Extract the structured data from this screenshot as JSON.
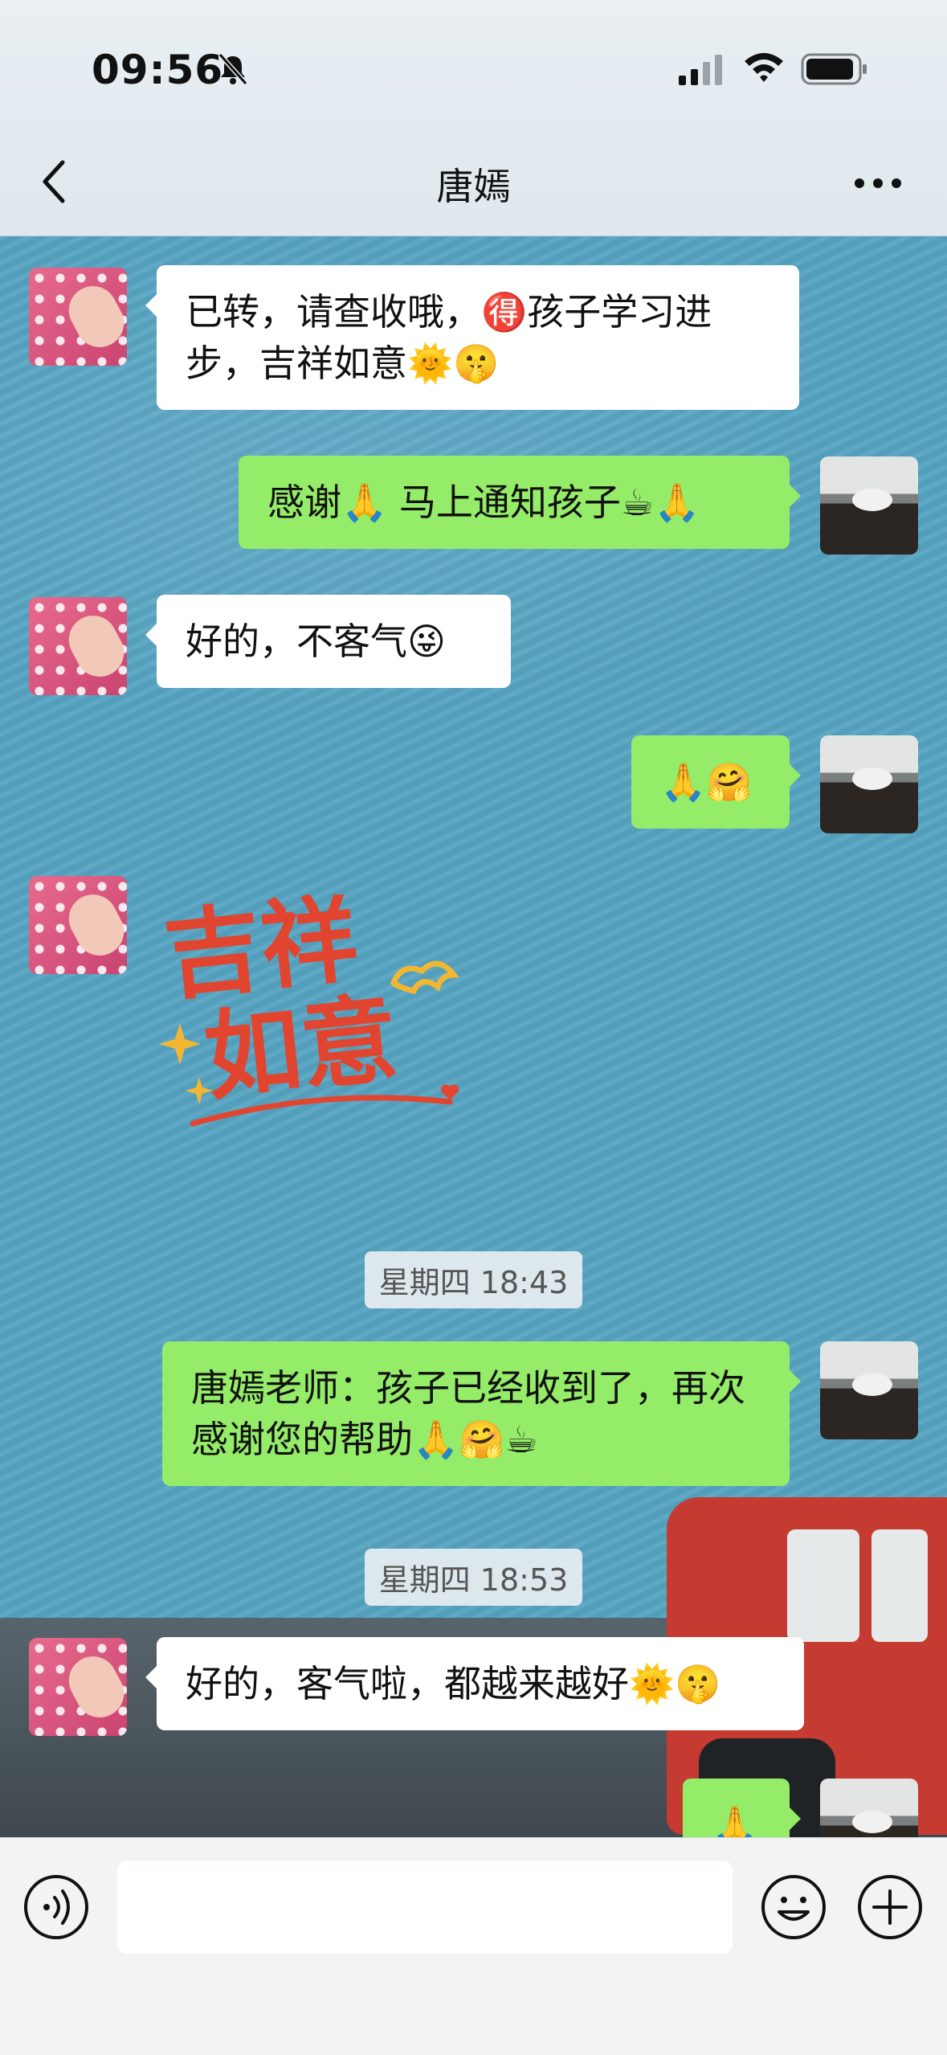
{
  "status_bar": {
    "time": "09:56",
    "icons": [
      "bell-muted-icon",
      "signal-icon",
      "wifi-icon",
      "battery-icon"
    ]
  },
  "nav": {
    "title": "唐嫣",
    "back_icon": "chevron-left-icon",
    "more_icon": "more-icon"
  },
  "messages": [
    {
      "side": "in",
      "text": "已转，请查收哦，🉐孩子学习进步，吉祥如意🌞🤫"
    },
    {
      "side": "out",
      "text": "感谢🙏 马上通知孩子☕🙏"
    },
    {
      "side": "in",
      "text": "好的，不客气😜"
    },
    {
      "side": "out",
      "text": "🙏🤗"
    },
    {
      "side": "in",
      "type": "sticker",
      "sticker_text_line1": "吉祥",
      "sticker_text_line2": "如意"
    },
    {
      "type": "time",
      "text": "星期四 18:43"
    },
    {
      "side": "out",
      "text": "唐嫣老师：孩子已经收到了，再次感谢您的帮助🙏🤗☕"
    },
    {
      "type": "time",
      "text": "星期四 18:53"
    },
    {
      "side": "in",
      "text": "好的，客气啦，都越来越好🌞🤫"
    },
    {
      "side": "out",
      "text": "🙏"
    }
  ],
  "input_bar": {
    "voice_icon": "voice-icon",
    "input_value": "",
    "emoji_icon": "emoji-icon",
    "plus_icon": "plus-icon"
  },
  "colors": {
    "chat_background": "#56a4c2",
    "bubble_out": "#95ec69",
    "bubble_in": "#ffffff",
    "sticker_red": "#e2452f",
    "sticker_gold": "#f2b632"
  }
}
